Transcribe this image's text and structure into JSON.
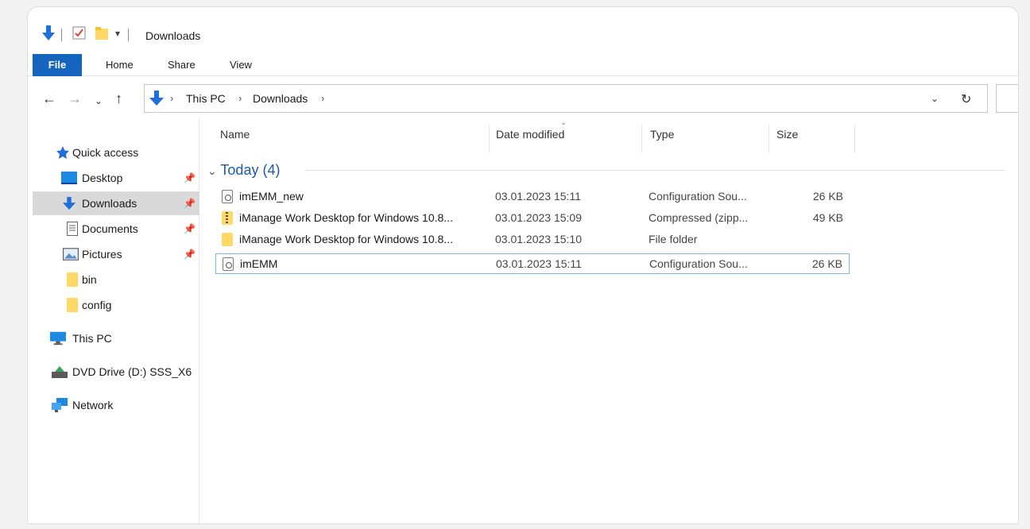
{
  "window": {
    "title": "Downloads"
  },
  "ribbon": {
    "tabs": [
      "File",
      "Home",
      "Share",
      "View"
    ]
  },
  "address": {
    "segments": [
      "This PC",
      "Downloads"
    ]
  },
  "sidebar": {
    "items": [
      {
        "label": "Quick access",
        "icon": "star-icon"
      },
      {
        "label": "Desktop",
        "icon": "desktop-icon",
        "pinned": true
      },
      {
        "label": "Downloads",
        "icon": "download-arrow-icon",
        "pinned": true,
        "selected": true
      },
      {
        "label": "Documents",
        "icon": "document-icon",
        "pinned": true
      },
      {
        "label": "Pictures",
        "icon": "pictures-icon",
        "pinned": true
      },
      {
        "label": "bin",
        "icon": "folder-icon"
      },
      {
        "label": "config",
        "icon": "folder-icon"
      },
      {
        "label": "This PC",
        "icon": "computer-icon"
      },
      {
        "label": "DVD Drive (D:) SSS_X6",
        "icon": "dvd-drive-icon"
      },
      {
        "label": "Network",
        "icon": "network-icon"
      }
    ]
  },
  "columns": [
    "Name",
    "Date modified",
    "Type",
    "Size"
  ],
  "group": {
    "label": "Today (4)"
  },
  "files": [
    {
      "name": "imEMM_new",
      "date": "03.01.2023 15:11",
      "type": "Configuration Sou...",
      "size": "26 KB",
      "icon": "config-file-icon"
    },
    {
      "name": "iManage Work Desktop for Windows 10.8...",
      "date": "03.01.2023 15:09",
      "type": "Compressed (zipp...",
      "size": "49 KB",
      "icon": "zip-folder-icon"
    },
    {
      "name": "iManage Work Desktop for Windows 10.8...",
      "date": "03.01.2023 15:10",
      "type": "File folder",
      "size": "",
      "icon": "folder-icon"
    },
    {
      "name": "imEMM",
      "date": "03.01.2023 15:11",
      "type": "Configuration Sou...",
      "size": "26 KB",
      "icon": "config-file-icon",
      "focused": true
    }
  ],
  "colors": {
    "accent": "#1565c0",
    "selection": "#d9d9d9",
    "focus_border": "#7eb4ea",
    "folder": "#ffd866"
  }
}
